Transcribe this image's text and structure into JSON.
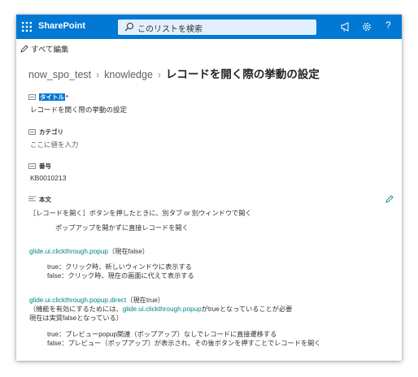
{
  "suite": {
    "brand": "SharePoint",
    "search_placeholder": "このリストを検索",
    "help_label": "?"
  },
  "command_bar": {
    "edit_all_label": "すべて編集"
  },
  "breadcrumb": {
    "site": "now_spo_test",
    "list": "knowledge",
    "current": "レコードを開く際の挙動の設定",
    "separator": "›"
  },
  "fields": {
    "title": {
      "label": "タイトル",
      "required_mark": "*",
      "value": "レコードを開く際の挙動の設定"
    },
    "category": {
      "label": "カテゴリ",
      "placeholder": "ここに値を入力"
    },
    "number": {
      "label": "番号",
      "value": "KB0010213"
    },
    "body": {
      "label": "本文"
    }
  },
  "body_content": {
    "line1": "［レコードを開く］ボタンを押したときに、別タブ or 別ウィンドウで開く",
    "line2": "ポップアップを開かずに直接レコードを開く",
    "p1_link": "glide.ui.clickthrough.popup",
    "p1_suffix": "（現在false）",
    "p1_true": "true：クリック時、新しいウィンドウに表示する",
    "p1_false": "false：クリック時、現在の画面に代えて表示する",
    "p2_link": "glide.ui.clickthrough.popup.direct",
    "p2_suffix": "（現在true）",
    "p2_note_prefix": "（機能を有効にするためには、",
    "p2_note_link": "glide.ui.clickthrough.popup",
    "p2_note_suffix": "がtrueとなっていることが必要",
    "p2_note2": "現在は実質falseとなっている）",
    "p2_true": "true：プレビューpopup関連（ポップアップ）なしでレコードに直接遷移する",
    "p2_false": "false：プレビュー（ポップアップ）が表示され、その後ボタンを押すことでレコードを開く"
  },
  "colors": {
    "suite_bar": "#0078d4",
    "link": "#038387",
    "highlight": "#0078d4"
  },
  "icons": [
    "app-launcher-icon",
    "search-icon",
    "megaphone-icon",
    "settings-gear-icon",
    "help-icon",
    "pencil-icon",
    "field-text-icon",
    "rich-text-icon"
  ]
}
